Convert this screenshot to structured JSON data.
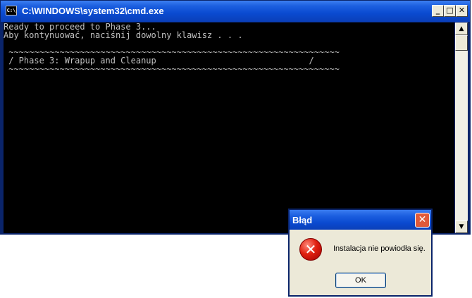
{
  "cmd_window": {
    "title": "C:\\WINDOWS\\system32\\cmd.exe",
    "icon_label": "C:\\",
    "controls": {
      "minimize": "_",
      "maximize": "□",
      "close": "✕"
    },
    "console_text": "Ready to proceed to Phase 3...\nAby kontynuować, naciśnij dowolny klawisz . . .\n\n ~~~~~~~~~~~~~~~~~~~~~~~~~~~~~~~~~~~~~~~~~~~~~~~~~~~~~~~~~~~~~~~~~\n / Phase 3: Wrapup and Cleanup                              /\n ~~~~~~~~~~~~~~~~~~~~~~~~~~~~~~~~~~~~~~~~~~~~~~~~~~~~~~~~~~~~~~~~~",
    "scrollbar": {
      "up": "▲",
      "down": "▼"
    }
  },
  "error_dialog": {
    "title": "Błąd",
    "close": "✕",
    "icon_glyph": "✕",
    "message": "Instalacja nie powiodła się.",
    "ok_label": "OK"
  }
}
